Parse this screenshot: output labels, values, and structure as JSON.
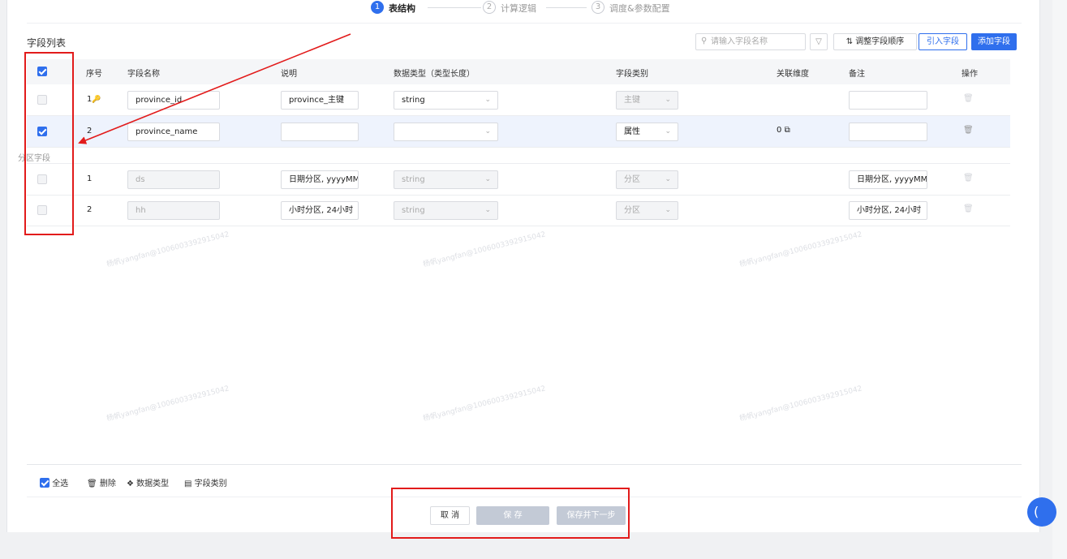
{
  "steps": [
    {
      "num": "1",
      "label": "表结构",
      "state": "active"
    },
    {
      "num": "2",
      "label": "计算逻辑",
      "state": "todo"
    },
    {
      "num": "3",
      "label": "调度&参数配置",
      "state": "todo"
    }
  ],
  "section_title": "字段列表",
  "toolbar": {
    "search_placeholder": "请输入字段名称",
    "order_label": "调整字段顺序",
    "import_label": "引入字段",
    "add_label": "添加字段"
  },
  "table": {
    "headers": [
      "序号",
      "字段名称",
      "说明",
      "数据类型（类型长度）",
      "字段类别",
      "关联维度",
      "备注",
      "操作"
    ],
    "rows": [
      {
        "idx": "1",
        "name": "province_id",
        "desc": "province_主键",
        "dtype": "string",
        "category": "主键",
        "dim": "",
        "note": "",
        "checked": false
      },
      {
        "idx": "2",
        "name": "province_name",
        "desc": "",
        "dtype": "",
        "category": "属性",
        "dim": "0",
        "note": "",
        "checked": true
      }
    ],
    "partition_label": "分区字段",
    "partition_rows": [
      {
        "idx": "1",
        "name": "ds",
        "desc": "日期分区, yyyyMM",
        "dtype": "string",
        "category": "分区",
        "note": "日期分区, yyyyMM"
      },
      {
        "idx": "2",
        "name": "hh",
        "desc": "小时分区, 24小时",
        "dtype": "string",
        "category": "分区",
        "note": "小时分区, 24小时"
      }
    ]
  },
  "bottom_tools": {
    "select_all": "全选",
    "delete": "删除",
    "data_type": "数据类型",
    "field_category": "字段类别"
  },
  "footer": {
    "cancel": "取 消",
    "save": "保 存",
    "save_next": "保存并下一步"
  },
  "watermark": "杨帆yangfan@1006003392915042",
  "colors": {
    "primary": "#2f6fed",
    "annotation": "#e21b1b"
  }
}
